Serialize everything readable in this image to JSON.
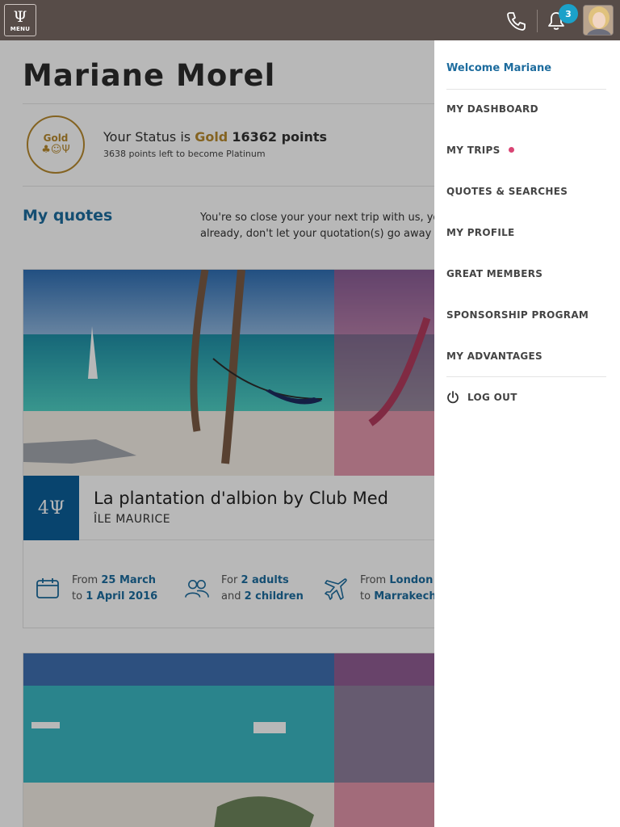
{
  "header": {
    "menu_label": "MENU",
    "menu_logo": "Ψ",
    "notification_count": "3"
  },
  "profile": {
    "name": "Mariane Morel",
    "status_prefix": "Your Status is",
    "status_level": "Gold",
    "status_points": "16362 points",
    "status_sub": "3638 points left to become Platinum",
    "badge_word": "Gold"
  },
  "quotes": {
    "title": "My quotes",
    "text_line1": "You're so close your your next trip with us, yo",
    "text_line2": "already, don't let your quotation(s) go away w"
  },
  "quote_card": {
    "trident": "4Ψ",
    "resort": "La plantation d'albion by Club Med",
    "location": "ÎLE MAURICE",
    "dates_from_label": "From",
    "dates_from": "25 March",
    "dates_to_label": "to",
    "dates_to": "1 April 2016",
    "travelers_for_label": "For",
    "travelers_adults": "2 adults",
    "travelers_and_label": "and",
    "travelers_children": "2 children",
    "flight_from_label": "From",
    "flight_from": "London",
    "flight_to_label": "to",
    "flight_to": "Marrakech"
  },
  "side_menu": {
    "welcome": "Welcome Mariane",
    "items": [
      {
        "label": "MY DASHBOARD"
      },
      {
        "label": "MY TRIPS"
      },
      {
        "label": "QUOTES & SEARCHES"
      },
      {
        "label": "MY PROFILE"
      },
      {
        "label": "GREAT MEMBERS"
      },
      {
        "label": "SPONSORSHIP PROGRAM"
      },
      {
        "label": "MY ADVANTAGES"
      }
    ],
    "logout": "LOG OUT"
  },
  "colors": {
    "accent_blue": "#1d6c9e",
    "gold": "#b8892e",
    "topbar": "#574c48",
    "notification_badge": "#1ba1c9",
    "new_dot": "#d94574"
  }
}
